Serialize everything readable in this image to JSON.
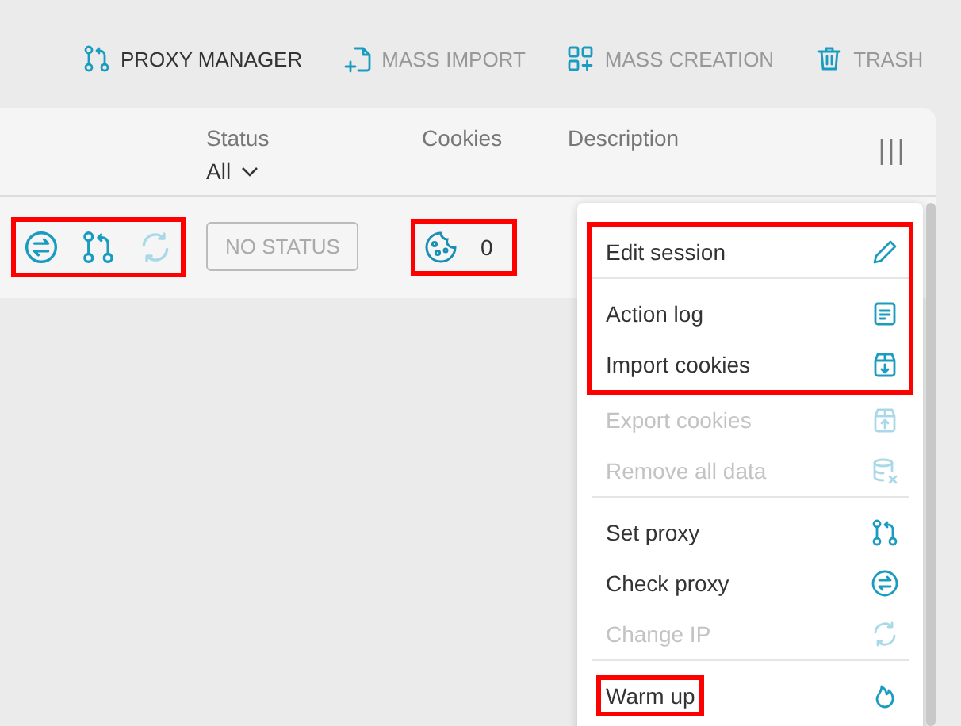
{
  "toolbar": [
    {
      "label": "PROXY MANAGER",
      "kind": "proxy",
      "disabled": false
    },
    {
      "label": "MASS IMPORT",
      "kind": "import",
      "disabled": true
    },
    {
      "label": "MASS CREATION",
      "kind": "create",
      "disabled": true
    },
    {
      "label": "TRASH",
      "kind": "trash",
      "disabled": true
    }
  ],
  "table": {
    "columns": [
      {
        "label": "Status",
        "filter": "All"
      },
      {
        "label": "Cookies"
      },
      {
        "label": "Description"
      }
    ],
    "row": {
      "actions": [
        {
          "kind": "check",
          "disabled": false
        },
        {
          "kind": "proxy",
          "disabled": false
        },
        {
          "kind": "ip",
          "disabled": true
        }
      ],
      "actions_highlighted": true,
      "status": "NO STATUS",
      "cookies": "0",
      "cookies_highlighted": true
    }
  },
  "menu": {
    "groups": [
      {
        "highlighted": true,
        "items": [
          {
            "label": "Edit session",
            "kind": "edit",
            "disabled": false,
            "divider_after": true,
            "label_highlighted": false
          },
          {
            "label": "Action log",
            "kind": "log",
            "disabled": false,
            "divider_after": false,
            "label_highlighted": false
          },
          {
            "label": "Import cookies",
            "kind": "import",
            "disabled": false,
            "divider_after": false,
            "label_highlighted": false
          }
        ]
      },
      {
        "highlighted": false,
        "items": [
          {
            "label": "Export cookies",
            "kind": "export",
            "disabled": true,
            "divider_after": false,
            "label_highlighted": false
          },
          {
            "label": "Remove all data",
            "kind": "remove",
            "disabled": true,
            "divider_after": true,
            "label_highlighted": false
          },
          {
            "label": "Set proxy",
            "kind": "proxy",
            "disabled": false,
            "divider_after": false,
            "label_highlighted": false
          },
          {
            "label": "Check proxy",
            "kind": "check",
            "disabled": false,
            "divider_after": false,
            "label_highlighted": false
          },
          {
            "label": "Change IP",
            "kind": "ip",
            "disabled": true,
            "divider_after": true,
            "label_highlighted": false
          },
          {
            "label": "Warm up",
            "kind": "warmup",
            "disabled": false,
            "divider_after": false,
            "label_highlighted": true
          }
        ]
      }
    ]
  }
}
